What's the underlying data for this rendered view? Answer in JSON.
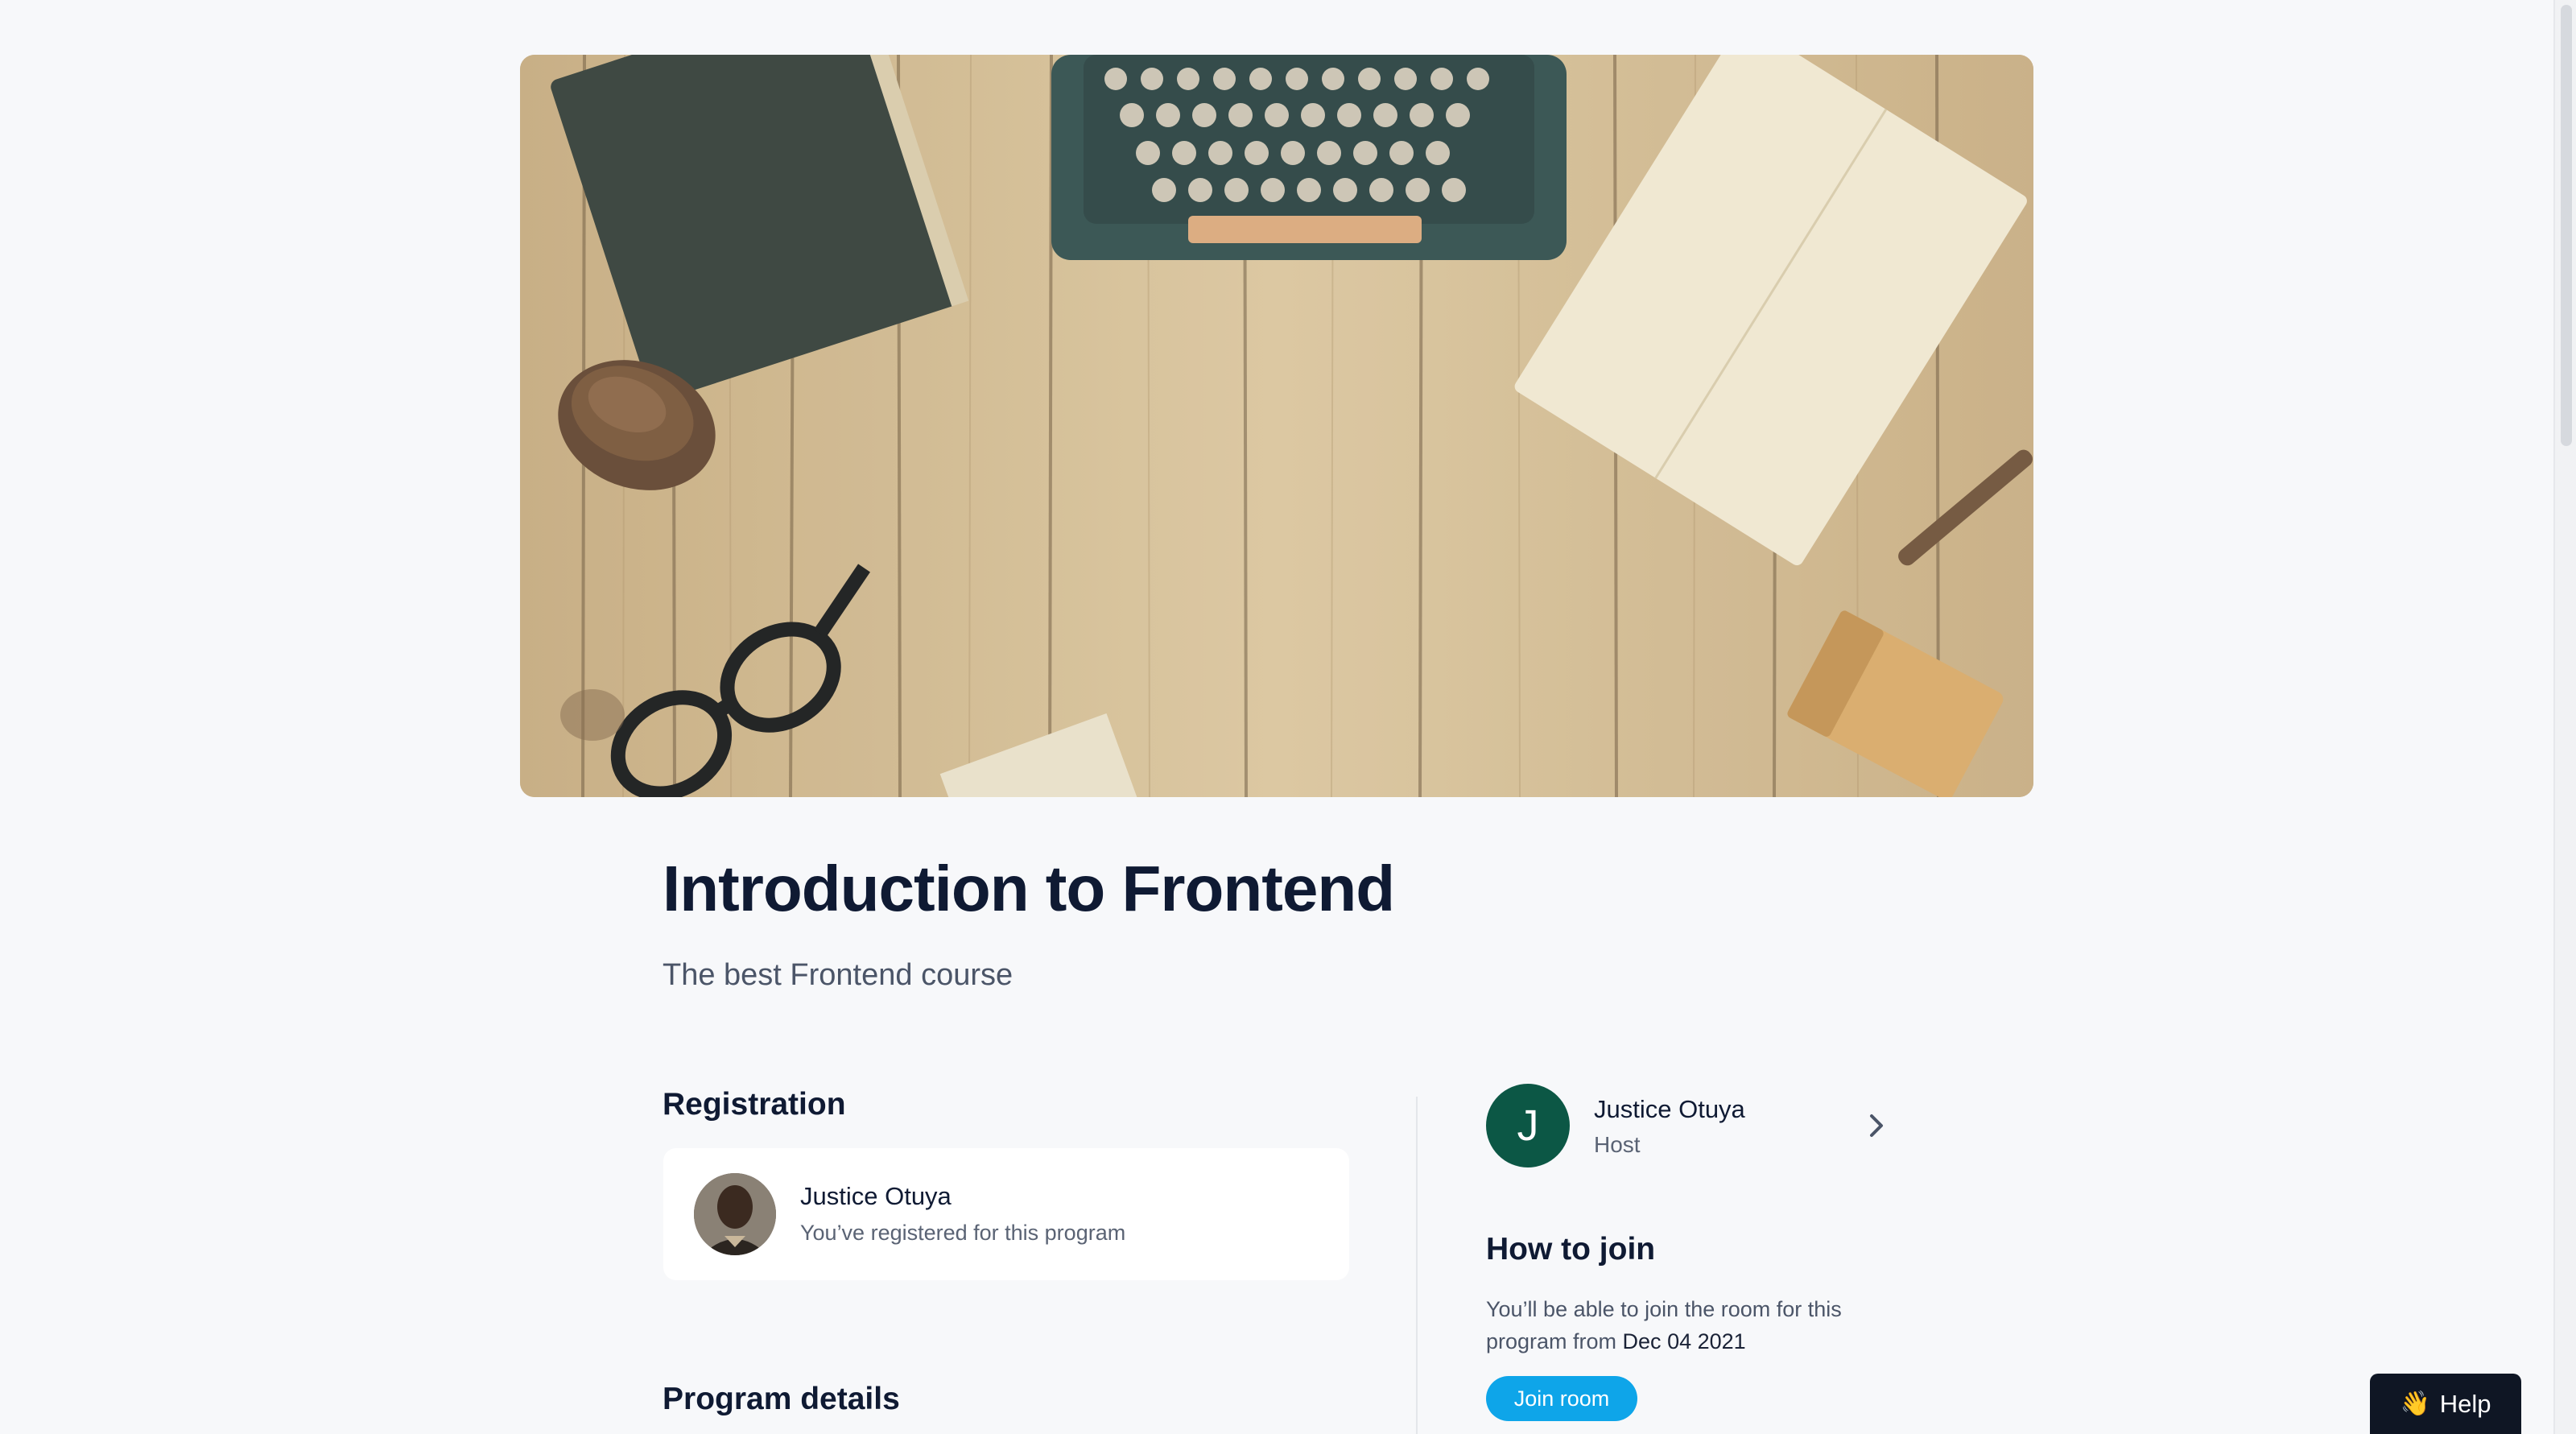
{
  "hero": {
    "image_alt": "Typewriter, book, notebook and glasses on wooden table"
  },
  "program": {
    "title": "Introduction to Frontend",
    "subtitle": "The best Frontend course"
  },
  "registration": {
    "heading": "Registration",
    "user_name": "Justice Otuya",
    "status_text": "You’ve registered for this program"
  },
  "host": {
    "initial": "J",
    "name": "Justice Otuya",
    "role": "Host"
  },
  "how_to_join": {
    "heading": "How to join",
    "text_prefix": "You’ll be able to join the room for this program from ",
    "date": "Dec 04 2021",
    "button_label": "Join room"
  },
  "program_details": {
    "heading": "Program details"
  },
  "help": {
    "icon": "waving-hand-icon",
    "label": "Help"
  },
  "colors": {
    "accent": "#0ea5e9",
    "host_avatar": "#0c5745",
    "help_button": "#0f1624"
  }
}
